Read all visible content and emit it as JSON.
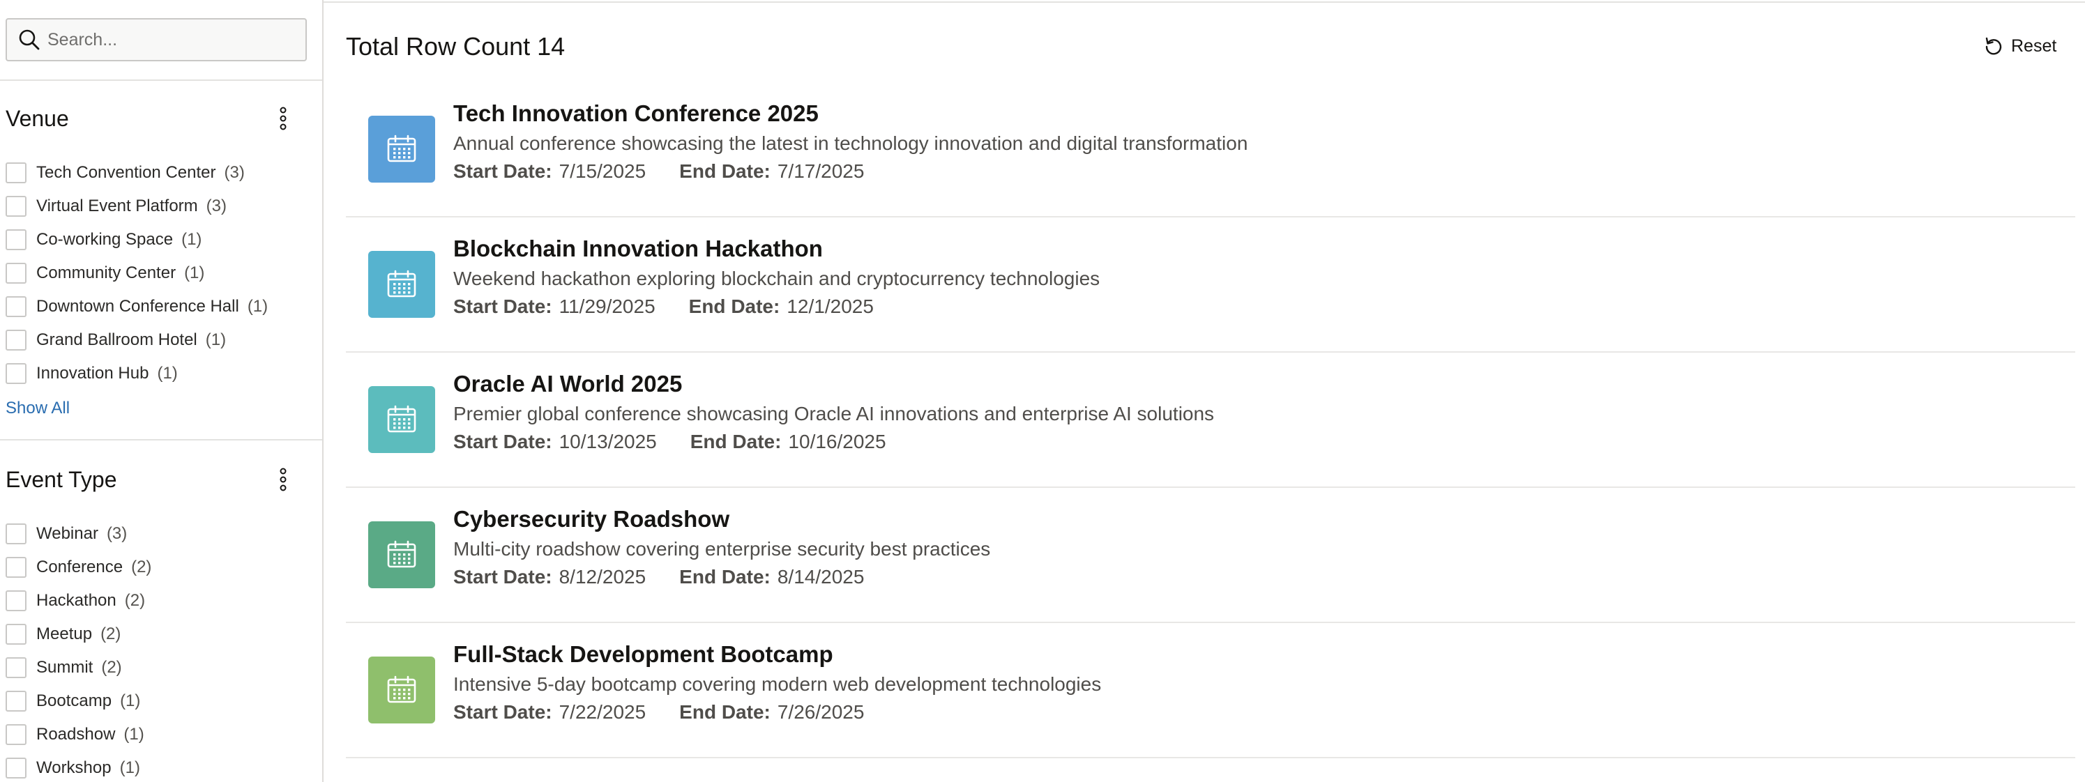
{
  "search": {
    "placeholder": "Search..."
  },
  "facets": [
    {
      "title": "Venue",
      "options": [
        {
          "label": "Tech Convention Center",
          "count": "(3)"
        },
        {
          "label": "Virtual Event Platform",
          "count": "(3)"
        },
        {
          "label": "Co-working Space",
          "count": "(1)"
        },
        {
          "label": "Community Center",
          "count": "(1)"
        },
        {
          "label": "Downtown Conference Hall",
          "count": "(1)"
        },
        {
          "label": "Grand Ballroom Hotel",
          "count": "(1)"
        },
        {
          "label": "Innovation Hub",
          "count": "(1)"
        }
      ],
      "show_all": "Show All"
    },
    {
      "title": "Event Type",
      "options": [
        {
          "label": "Webinar",
          "count": "(3)"
        },
        {
          "label": "Conference",
          "count": "(2)"
        },
        {
          "label": "Hackathon",
          "count": "(2)"
        },
        {
          "label": "Meetup",
          "count": "(2)"
        },
        {
          "label": "Summit",
          "count": "(2)"
        },
        {
          "label": "Bootcamp",
          "count": "(1)"
        },
        {
          "label": "Roadshow",
          "count": "(1)"
        },
        {
          "label": "Workshop",
          "count": "(1)"
        }
      ]
    }
  ],
  "results": {
    "row_count_label": "Total Row Count 14",
    "reset_label": "Reset",
    "start_label": "Start Date:",
    "end_label": "End Date:",
    "events": [
      {
        "title": "Tech Innovation Conference 2025",
        "description": "Annual conference showcasing the latest in technology innovation and digital transformation",
        "start": "7/15/2025",
        "end": "7/17/2025",
        "color": "#5a9fd9",
        "icon": "calendar-icon"
      },
      {
        "title": "Blockchain Innovation Hackathon",
        "description": "Weekend hackathon exploring blockchain and cryptocurrency technologies",
        "start": "11/29/2025",
        "end": "12/1/2025",
        "color": "#56b3cf",
        "icon": "calendar-icon"
      },
      {
        "title": "Oracle AI World 2025",
        "description": "Premier global conference showcasing Oracle AI innovations and enterprise AI solutions",
        "start": "10/13/2025",
        "end": "10/16/2025",
        "color": "#5cbcbd",
        "icon": "calendar-icon"
      },
      {
        "title": "Cybersecurity Roadshow",
        "description": "Multi-city roadshow covering enterprise security best practices",
        "start": "8/12/2025",
        "end": "8/14/2025",
        "color": "#5aaa86",
        "icon": "calendar-icon"
      },
      {
        "title": "Full-Stack Development Bootcamp",
        "description": "Intensive 5-day bootcamp covering modern web development technologies",
        "start": "7/22/2025",
        "end": "7/26/2025",
        "color": "#8fbf6c",
        "icon": "calendar-icon"
      }
    ]
  }
}
